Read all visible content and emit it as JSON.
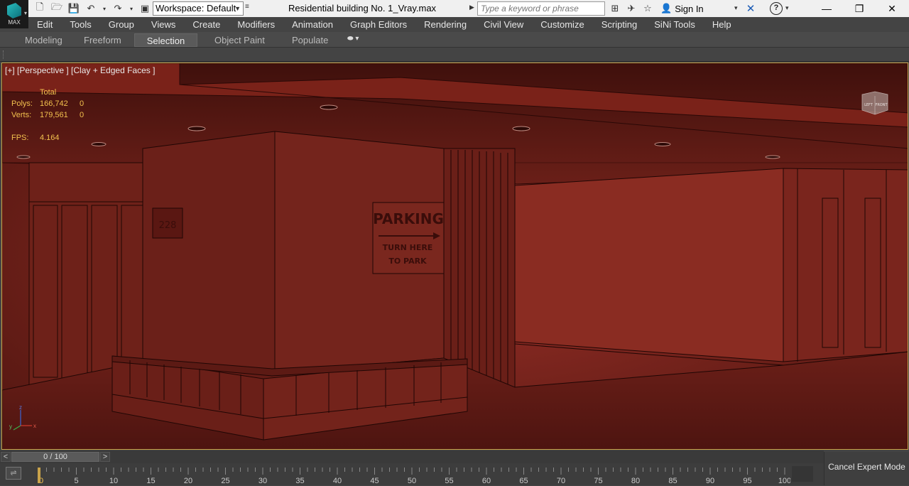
{
  "app": {
    "logo_text": "MAX",
    "document_title": "Residential building No. 1_Vray.max",
    "workspace_label": "Workspace: Default",
    "search_placeholder": "Type a keyword or phrase",
    "sign_in_label": "Sign In"
  },
  "menubar": {
    "items": [
      "Edit",
      "Tools",
      "Group",
      "Views",
      "Create",
      "Modifiers",
      "Animation",
      "Graph Editors",
      "Rendering",
      "Civil View",
      "Customize",
      "Scripting",
      "SiNi Tools",
      "Help"
    ]
  },
  "ribbon": {
    "tabs": [
      {
        "label": "Modeling",
        "active": false
      },
      {
        "label": "Freeform",
        "active": false
      },
      {
        "label": "Selection",
        "active": true
      },
      {
        "label": "Object Paint",
        "active": false
      },
      {
        "label": "Populate",
        "active": false
      }
    ]
  },
  "viewport": {
    "label": "[+] [Perspective ] [Clay + Edged Faces ]",
    "stats": {
      "header": "Total",
      "polys_label": "Polys:",
      "polys_total": "166,742",
      "polys_sel": "0",
      "verts_label": "Verts:",
      "verts_total": "179,561",
      "verts_sel": "0",
      "fps_label": "FPS:",
      "fps_value": "4.164"
    },
    "viewcube": {
      "left": "LEFT",
      "front": "FRONT"
    },
    "scene_text": {
      "room_number": "228",
      "sign_title": "PARKING",
      "sign_line1": "TURN HERE",
      "sign_line2": "TO PARK"
    },
    "axis": {
      "x": "x",
      "y": "y",
      "z": "z"
    }
  },
  "timeline": {
    "frame_display": "0 / 100",
    "prev": "<",
    "next": ">",
    "tick_labels": [
      "0",
      "5",
      "10",
      "15",
      "20",
      "25",
      "30",
      "35",
      "40",
      "45",
      "50",
      "55",
      "60",
      "65",
      "70",
      "75",
      "80",
      "85",
      "90",
      "95",
      "100"
    ]
  },
  "expert": {
    "cancel_label": "Cancel Expert Mode"
  },
  "colors": {
    "viewport_bg": "#5c1a15",
    "highlight": "#c9a34a",
    "stats": "#f2c14e"
  }
}
